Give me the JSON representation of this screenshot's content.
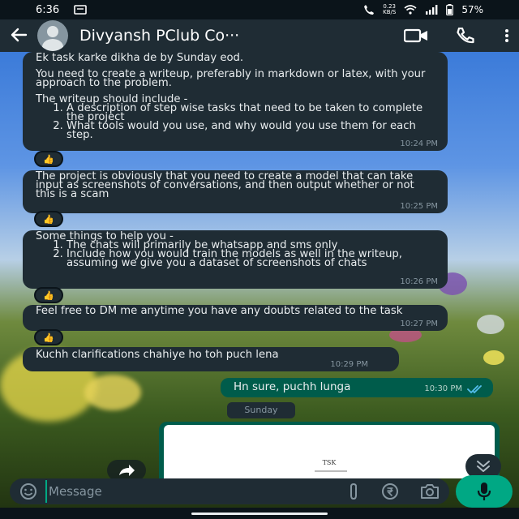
{
  "status_bar": {
    "time": "6:36",
    "speed_value": "0.23",
    "speed_unit": "KB/S",
    "battery": "57%"
  },
  "header": {
    "contact_name": "Divyansh PClub Co···"
  },
  "messages": [
    {
      "line1": "Ek task karke dikha de by Sunday eod.",
      "line2": "You need to create a writeup, preferably in markdown or latex, with your approach to the problem.",
      "line3": "The writeup should include -",
      "items": [
        "A description of step wise tasks that need to be taken to complete the project",
        "What tools would you use, and why would you use them for each step."
      ],
      "time": "10:24 PM",
      "reaction": "👍"
    },
    {
      "text": "The project is obviously that you need to create a model that can take input as screenshots of conversations, and then output whether or not this is a scam",
      "time": "10:25 PM",
      "reaction": "👍"
    },
    {
      "line1": "Some things to help you -",
      "items": [
        "The chats will primarily be whatsapp and sms only",
        "Include how you would train the models as well in the writeup, assuming we give you a dataset of screenshots of chats"
      ],
      "time": "10:26 PM",
      "reaction": "👍"
    },
    {
      "text": "Feel free to DM me anytime you have any doubts related to the task",
      "time": "10:27 PM",
      "reaction": "👍"
    },
    {
      "text": "Kuchh clarifications chahiye ho toh puch lena",
      "time": "10:29 PM"
    }
  ],
  "outgoing": {
    "text": "Hn sure, puchh lunga",
    "time": "10:30 PM"
  },
  "date_chip": "Sunday",
  "document_preview": {
    "text": "TSK"
  },
  "composer": {
    "placeholder": "Message"
  },
  "icons": {
    "back": "arrow-left-icon",
    "video": "video-camera-icon",
    "call": "phone-icon",
    "menu": "more-vertical-icon",
    "emoji": "emoji-icon",
    "attach": "paperclip-icon",
    "rupee": "rupee-icon",
    "camera": "camera-icon",
    "mic": "mic-icon"
  },
  "colors": {
    "header_bg": "#1f2c34",
    "incoming_bubble": "#1f2c34",
    "outgoing_bubble": "#005c4b",
    "accent": "#00a884",
    "read_ticks": "#53bdeb",
    "timestamp": "#8696a0"
  }
}
